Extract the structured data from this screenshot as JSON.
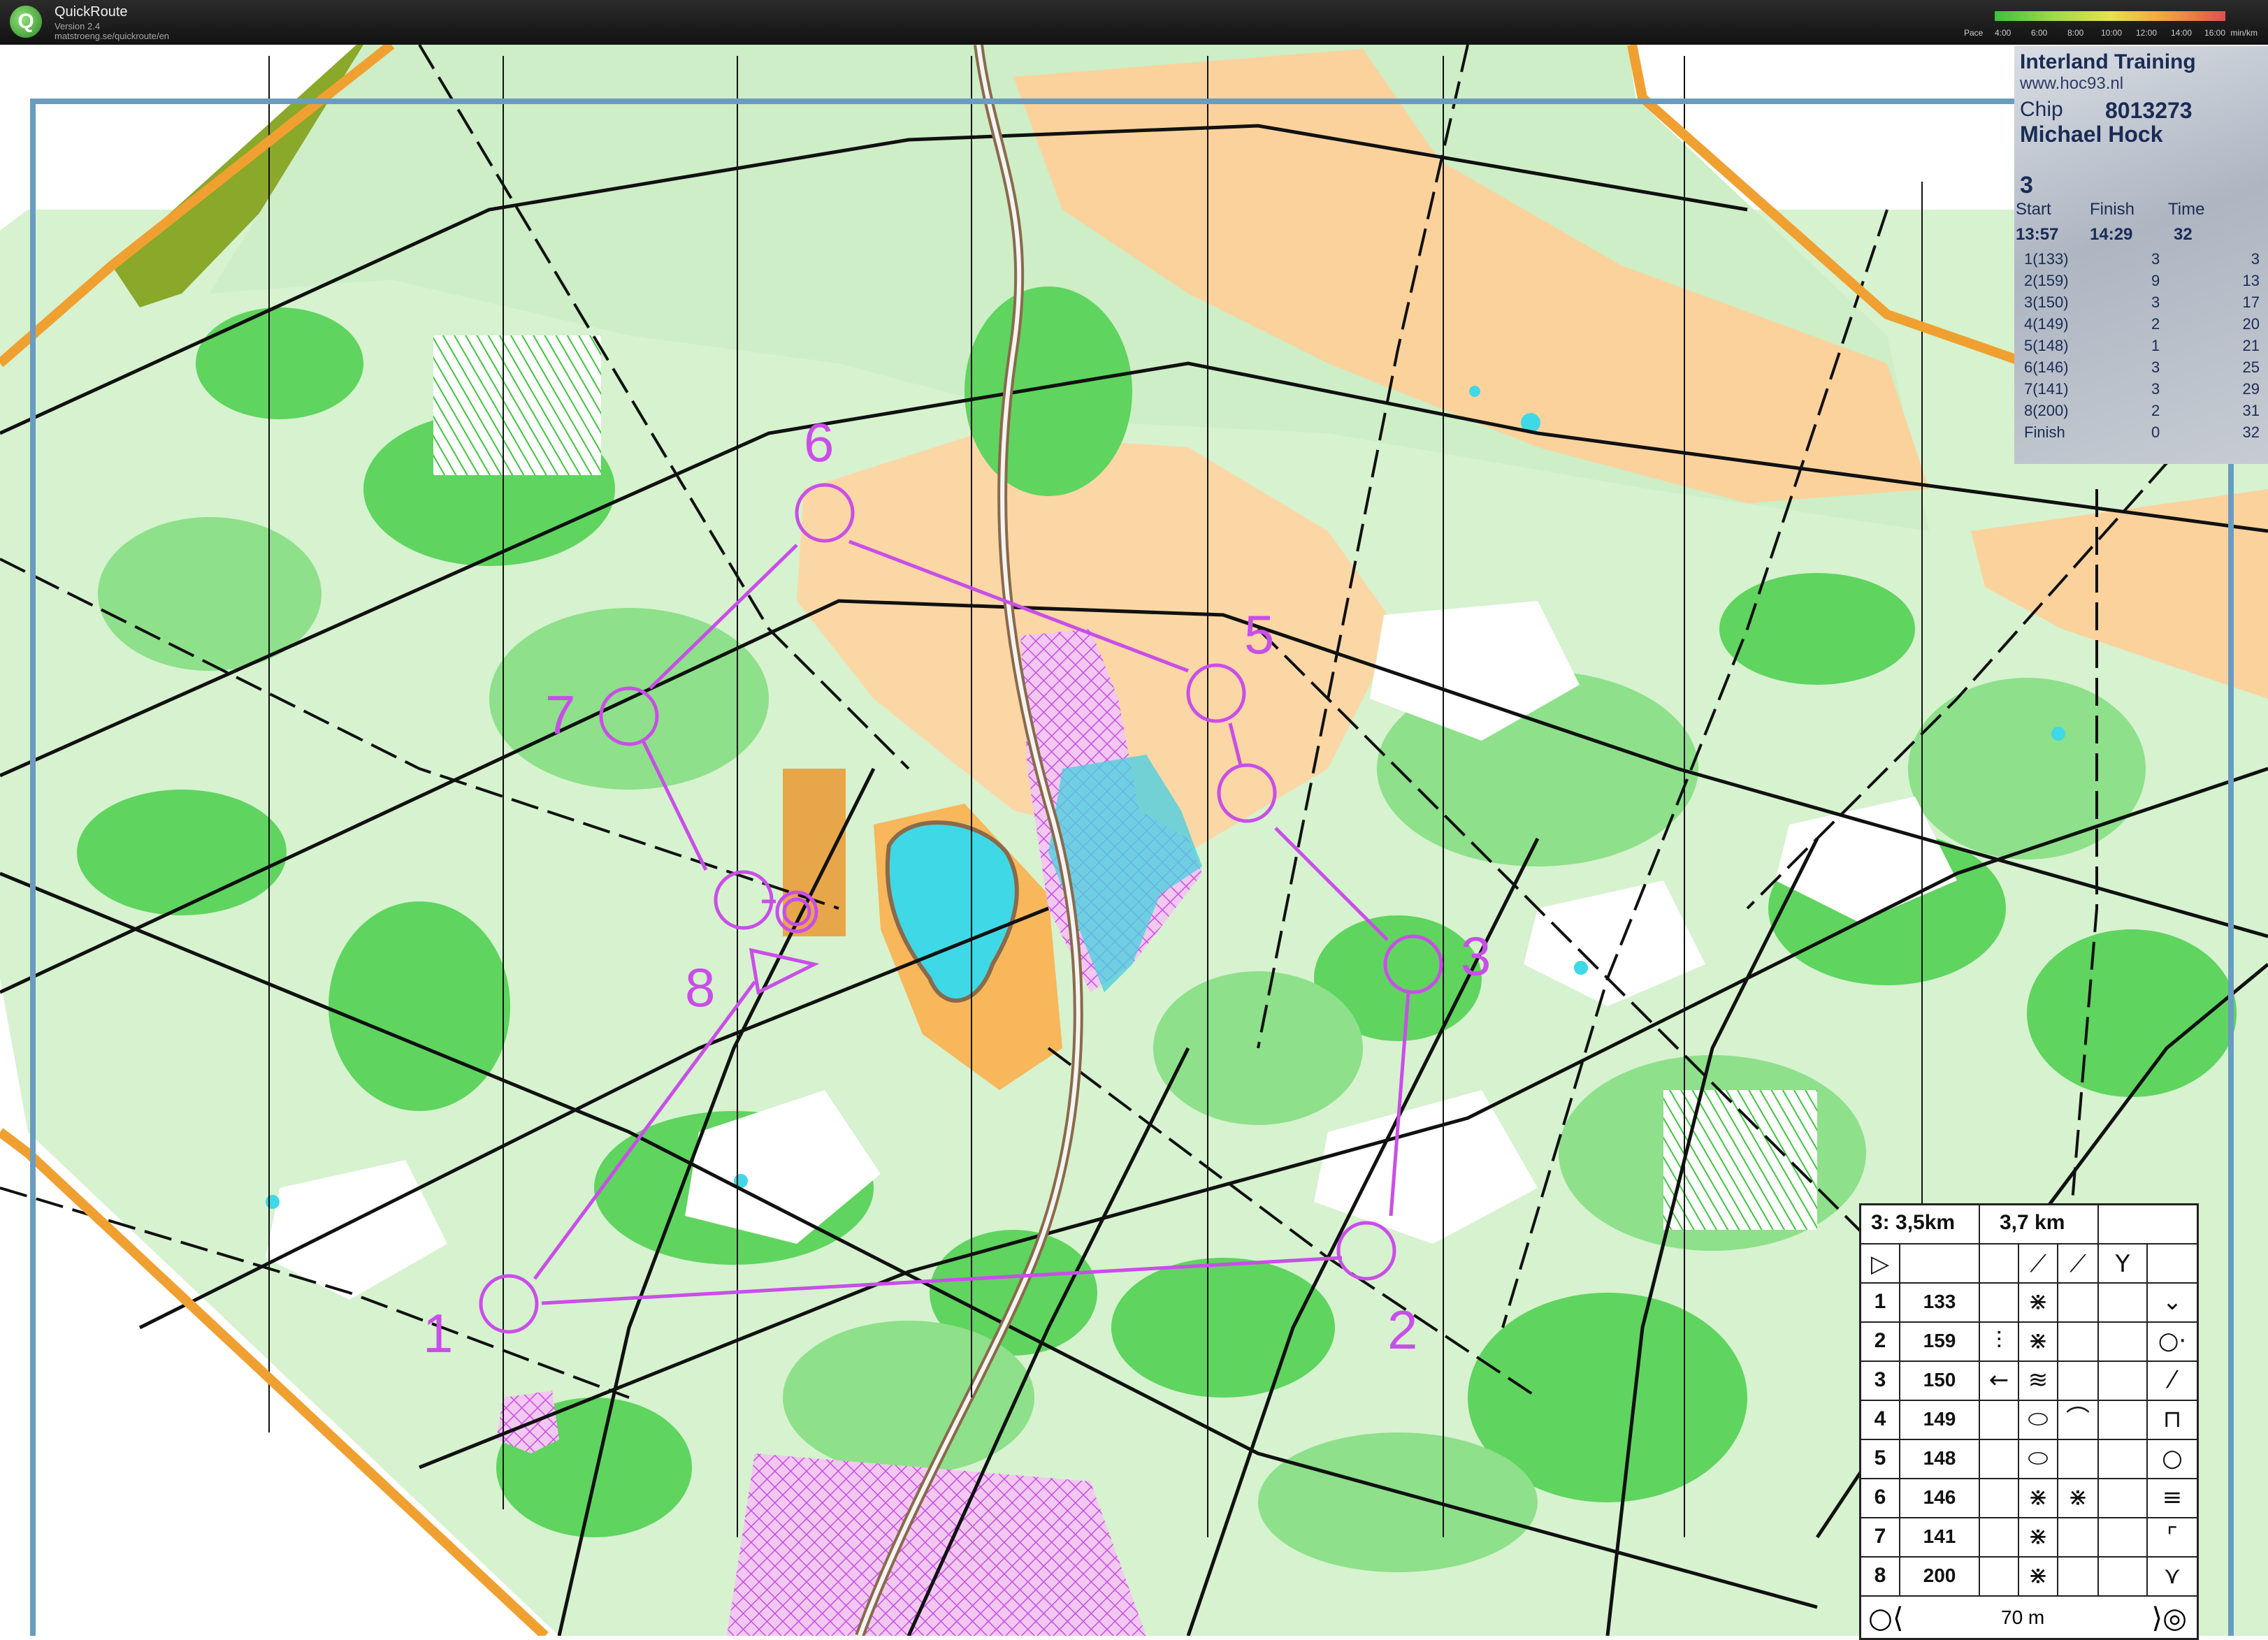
{
  "titlebar": {
    "app_name": "QuickRoute",
    "version": "Version 2.4",
    "url": "matstroeng.se/quickroute/en",
    "pace_label": "Pace",
    "pace_ticks": [
      "4:00",
      "6:00",
      "8:00",
      "10:00",
      "12:00",
      "14:00",
      "16:00"
    ],
    "pace_unit": "min/km"
  },
  "map": {
    "control_labels": [
      "1",
      "2",
      "3",
      "5",
      "6",
      "7",
      "8"
    ],
    "course_color": "#c94ee8",
    "frame_color": "#6a9cc0"
  },
  "punch_card": {
    "title": "Interland Training",
    "url": "www.hoc93.nl",
    "chip_label": "Chip",
    "chip_number": "8013273",
    "name": "Michael Hock",
    "course": "3",
    "start_label": "Start",
    "finish_label": "Finish",
    "time_label": "Time",
    "start": "13:57",
    "finish": "14:29",
    "time": "32",
    "splits": [
      {
        "control": "1(133)",
        "leg": "3",
        "cum": "3"
      },
      {
        "control": "2(159)",
        "leg": "9",
        "cum": "13"
      },
      {
        "control": "3(150)",
        "leg": "3",
        "cum": "17"
      },
      {
        "control": "4(149)",
        "leg": "2",
        "cum": "20"
      },
      {
        "control": "5(148)",
        "leg": "1",
        "cum": "21"
      },
      {
        "control": "6(146)",
        "leg": "3",
        "cum": "25"
      },
      {
        "control": "7(141)",
        "leg": "3",
        "cum": "29"
      },
      {
        "control": "8(200)",
        "leg": "2",
        "cum": "31"
      },
      {
        "control": "Finish",
        "leg": "0",
        "cum": "32"
      }
    ]
  },
  "description_sheet": {
    "course": "3: 3,5km",
    "length": "3,7 km",
    "start_symbol": "▷",
    "rows": [
      {
        "n": "1",
        "code": "133",
        "sym_f": "⋇",
        "sym_h": "⌄"
      },
      {
        "n": "2",
        "code": "159",
        "sym_e": "⫶",
        "sym_f": "⋇",
        "sym_h": "○·"
      },
      {
        "n": "3",
        "code": "150",
        "sym_e": "←",
        "sym_f": "≋",
        "sym_h": "⁄"
      },
      {
        "n": "4",
        "code": "149",
        "sym_f": "⬭",
        "sym_g": "⌒",
        "sym_h": "⊓"
      },
      {
        "n": "5",
        "code": "148",
        "sym_f": "⬭",
        "sym_h": "○"
      },
      {
        "n": "6",
        "code": "146",
        "sym_f": "⋇",
        "sym_g": "⋇",
        "sym_h": "≡"
      },
      {
        "n": "7",
        "code": "141",
        "sym_f": "⋇",
        "sym_h": "⌜"
      },
      {
        "n": "8",
        "code": "200",
        "sym_f": "⋇",
        "sym_h": "⋎"
      }
    ],
    "scale_label": "70 m"
  }
}
